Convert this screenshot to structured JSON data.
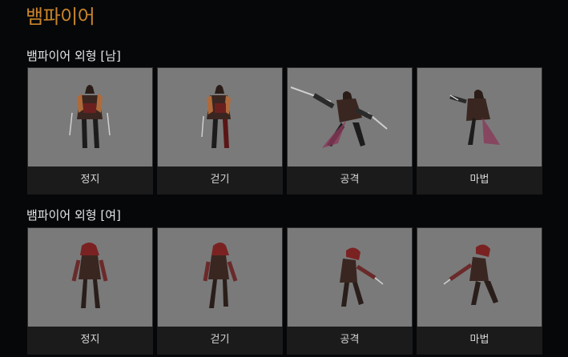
{
  "page": {
    "title": "뱀파이어"
  },
  "sections": [
    {
      "title": "뱀파이어 외형 [남]",
      "cards": [
        {
          "label": "정지"
        },
        {
          "label": "걷기"
        },
        {
          "label": "공격"
        },
        {
          "label": "마법"
        }
      ]
    },
    {
      "title": "뱀파이어  외형 [여]",
      "cards": [
        {
          "label": "정지"
        },
        {
          "label": "걷기"
        },
        {
          "label": "공격"
        },
        {
          "label": "마법"
        }
      ]
    }
  ],
  "colors": {
    "title": "#c9842a",
    "background": "#050709",
    "thumb": "#7a7a7a",
    "caption_bg": "#1b1b1b"
  }
}
